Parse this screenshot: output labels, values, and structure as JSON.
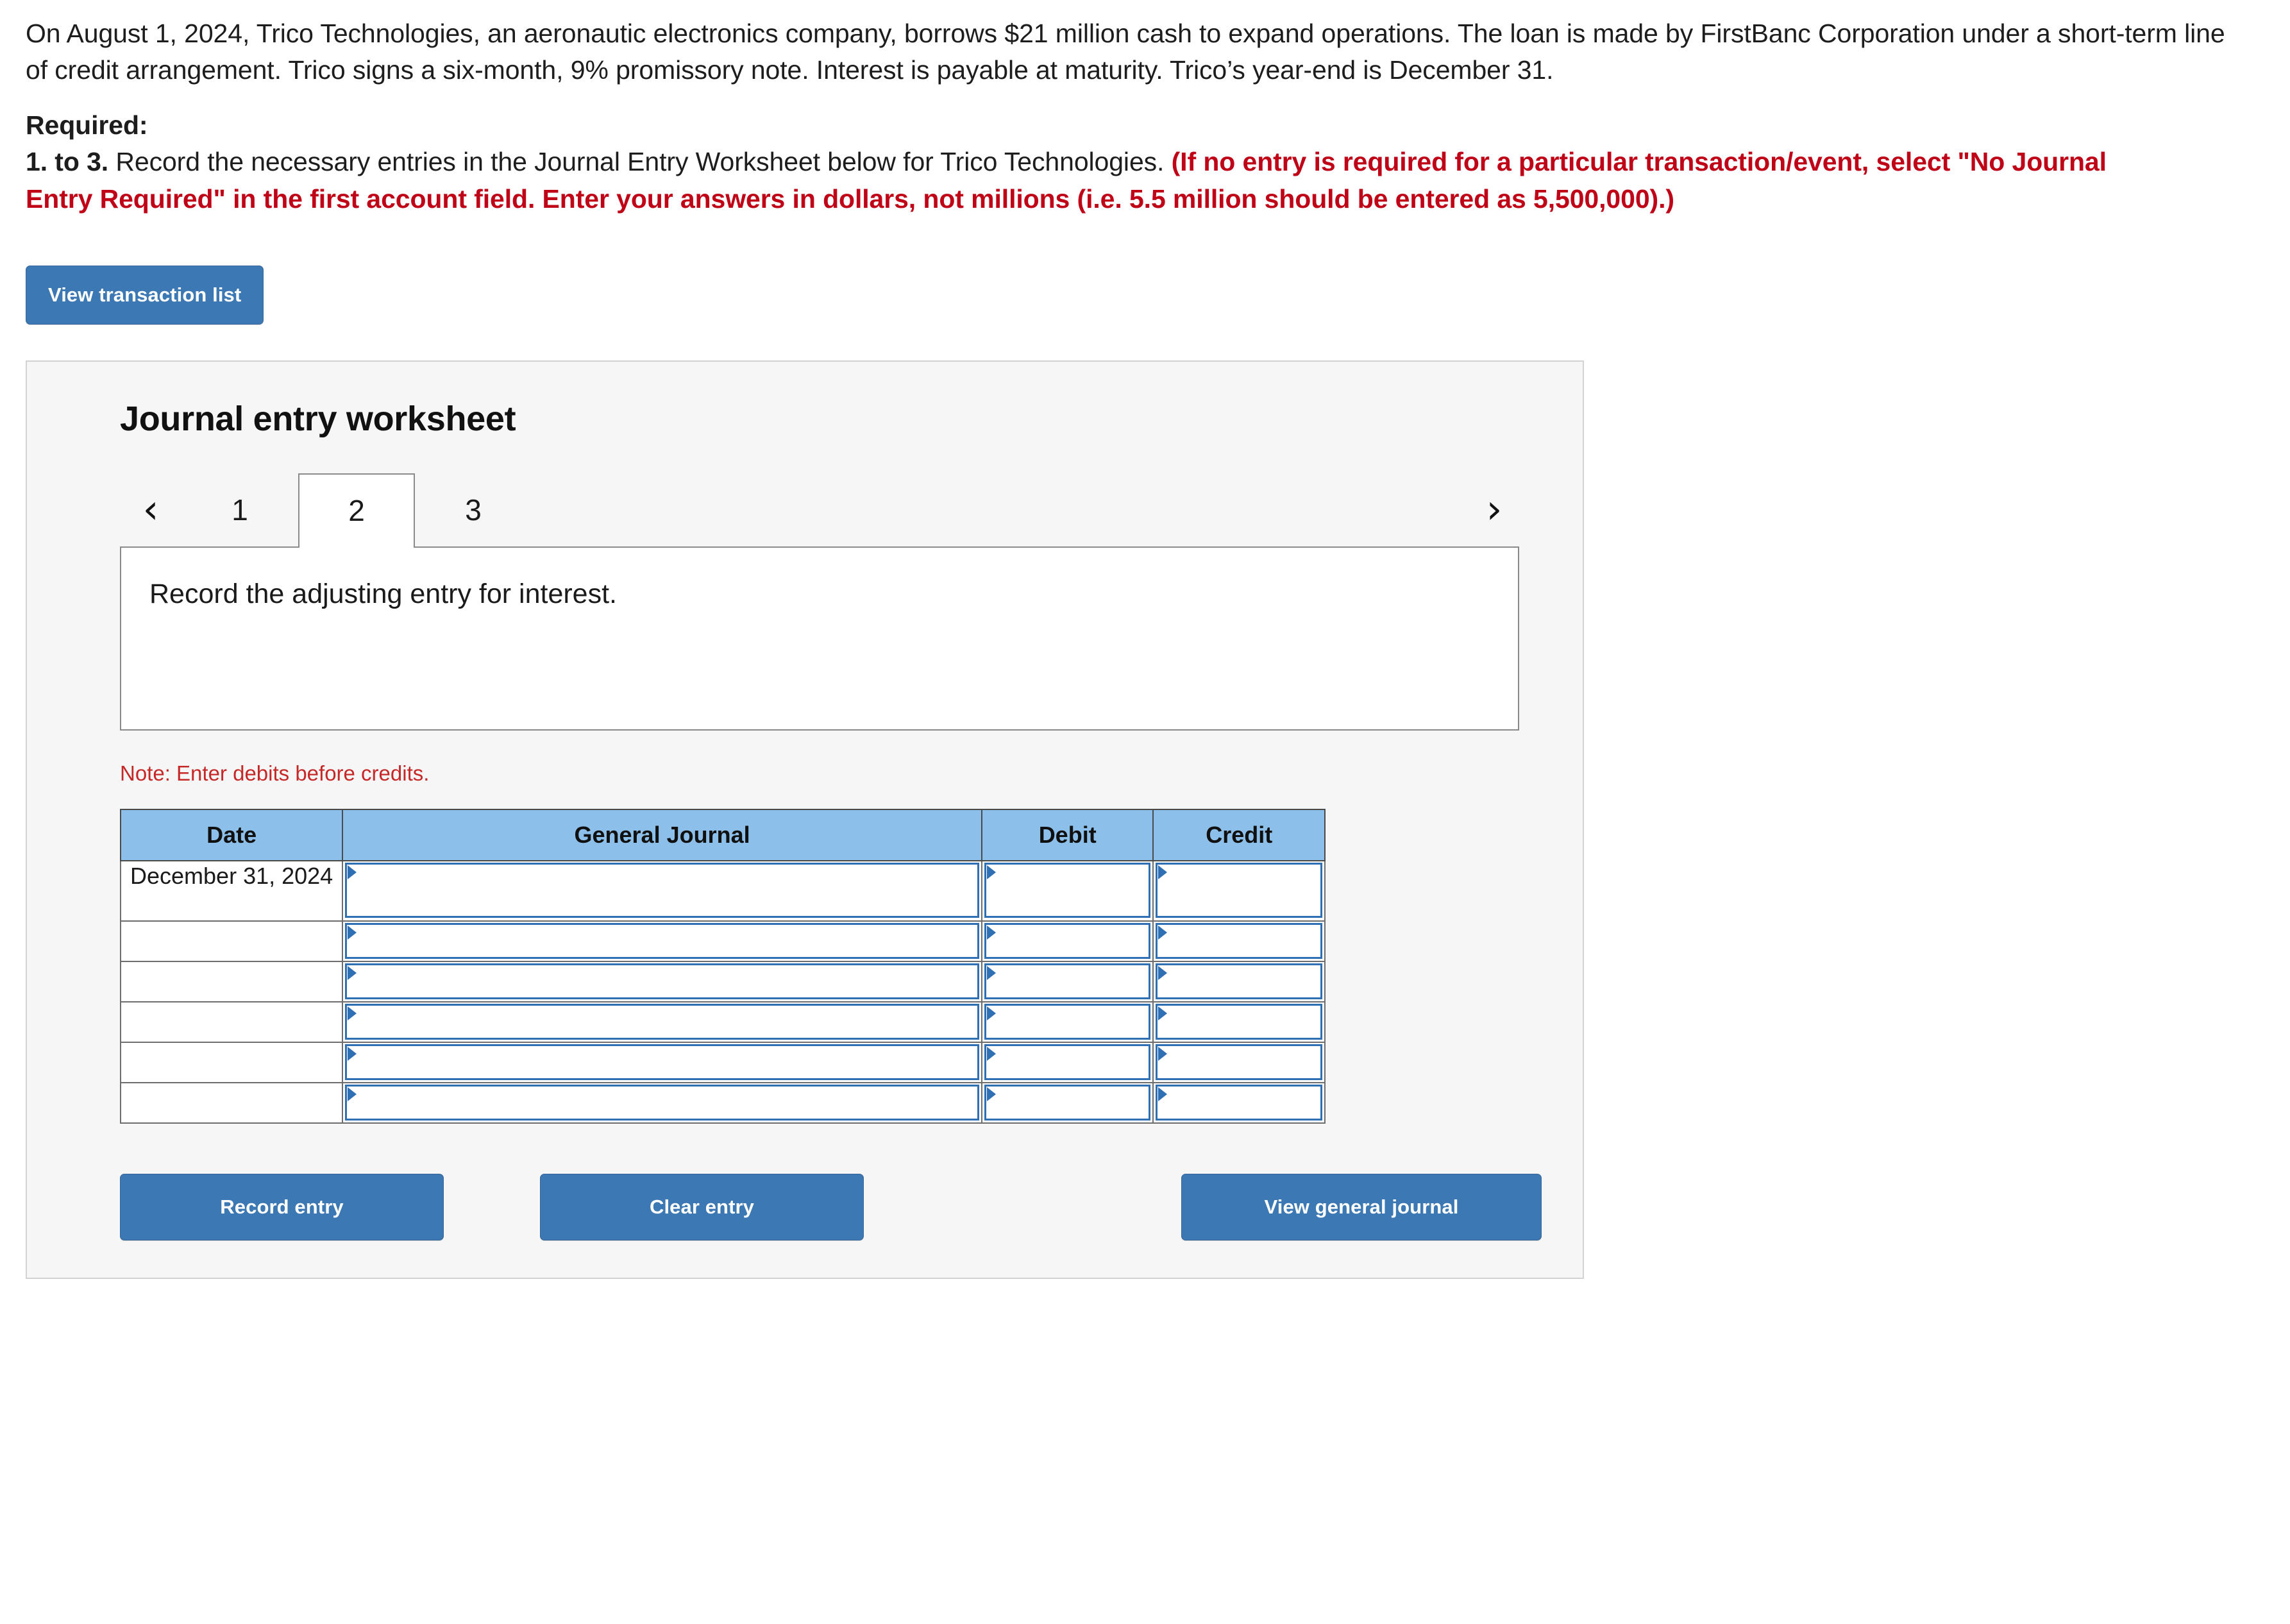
{
  "problem": {
    "paragraph": "On August 1, 2024, Trico Technologies, an aeronautic electronics company, borrows $21 million cash to expand operations. The loan is made by FirstBanc Corporation under a short-term line of credit arrangement. Trico signs a six-month, 9% promissory note. Interest is payable at maturity. Trico’s year-end is December 31.",
    "required_label": "Required:",
    "requirement_number": "1. to 3.",
    "requirement_text": " Record the necessary entries in the Journal Entry Worksheet below for Trico Technologies. ",
    "requirement_emphasis": "(If no entry is required for a particular transaction/event, select \"No Journal Entry Required\" in the first account field. Enter your answers in dollars, not millions (i.e. 5.5 million should be entered as 5,500,000).)"
  },
  "view_transaction_button": "View transaction list",
  "worksheet": {
    "title": "Journal entry worksheet",
    "prev_arrow": "‹",
    "next_arrow": "›",
    "tabs": [
      {
        "label": "1",
        "active": false
      },
      {
        "label": "2",
        "active": true
      },
      {
        "label": "3",
        "active": false
      }
    ],
    "description": "Record the adjusting entry for interest.",
    "note": "Note: Enter debits before credits.",
    "table": {
      "headers": [
        "Date",
        "General Journal",
        "Debit",
        "Credit"
      ],
      "rows": [
        {
          "date": "December 31, 2024",
          "general_journal": "",
          "debit": "",
          "credit": ""
        },
        {
          "date": "",
          "general_journal": "",
          "debit": "",
          "credit": ""
        },
        {
          "date": "",
          "general_journal": "",
          "debit": "",
          "credit": ""
        },
        {
          "date": "",
          "general_journal": "",
          "debit": "",
          "credit": ""
        },
        {
          "date": "",
          "general_journal": "",
          "debit": "",
          "credit": ""
        },
        {
          "date": "",
          "general_journal": "",
          "debit": "",
          "credit": ""
        }
      ]
    },
    "buttons": {
      "record": "Record entry",
      "clear": "Clear entry",
      "view_general_journal": "View general journal"
    }
  },
  "colors": {
    "accent_blue": "#3c78b4",
    "table_header_blue": "#8cc0ea",
    "field_border_blue": "#2f6fb3",
    "required_red": "#c00418",
    "note_red": "#c62828",
    "panel_bg": "#f6f6f6"
  }
}
